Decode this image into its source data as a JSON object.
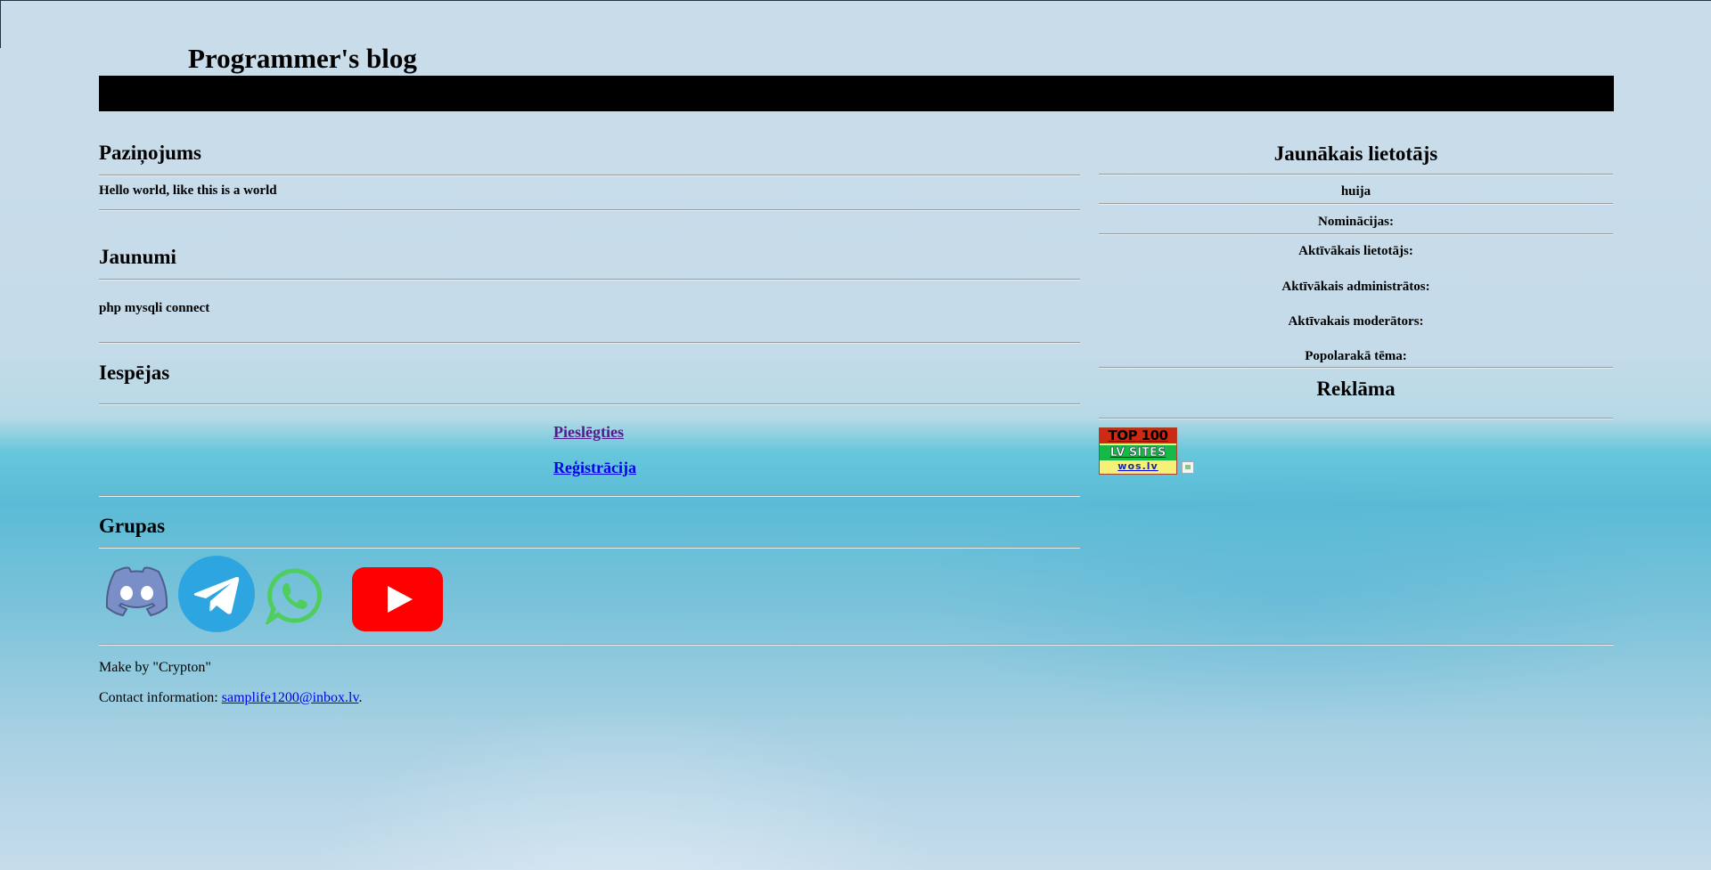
{
  "site": {
    "title": "Programmer's blog"
  },
  "left": {
    "announcement": {
      "heading": "Paziņojums",
      "text": "Hello world, like this is a world"
    },
    "news": {
      "heading": "Jaunumi",
      "items": [
        "php mysqli connect"
      ]
    },
    "options": {
      "heading": "Iespējas",
      "login_label": "Pieslēgties",
      "register_label": "Reģistrācija"
    },
    "groups": {
      "heading": "Grupas",
      "icons": [
        "discord-icon",
        "telegram-icon",
        "whatsapp-icon",
        "youtube-icon"
      ]
    }
  },
  "right": {
    "newest_user": {
      "heading": "Jaunākais lietotājs",
      "username": "huija",
      "nominations_label": "Nominācijas:",
      "most_active_user_label": "Aktīvākais lietotājs:",
      "most_active_admin_label": "Aktīvākais administrātos:",
      "most_active_moderator_label": "Aktīvakais moderātors:",
      "most_popular_topic_label": "Popolarakā tēma:"
    },
    "ads": {
      "heading": "Reklāma",
      "top100": {
        "line1": "TOP 100",
        "line2": "LV SITES",
        "line3": "wos.lv"
      }
    }
  },
  "footer": {
    "made_by": "Make by \"Crypton\"",
    "contact_prefix": "Contact information: ",
    "contact_email": "samplife1200@inbox.lv",
    "contact_suffix": "."
  },
  "colors": {
    "visited_link": "#551a8b",
    "link": "#0000ee",
    "header_bar": "#000000",
    "discord": "#7289da",
    "telegram": "#2ca5e0",
    "whatsapp": "#4fce5d",
    "youtube": "#ff0000"
  }
}
